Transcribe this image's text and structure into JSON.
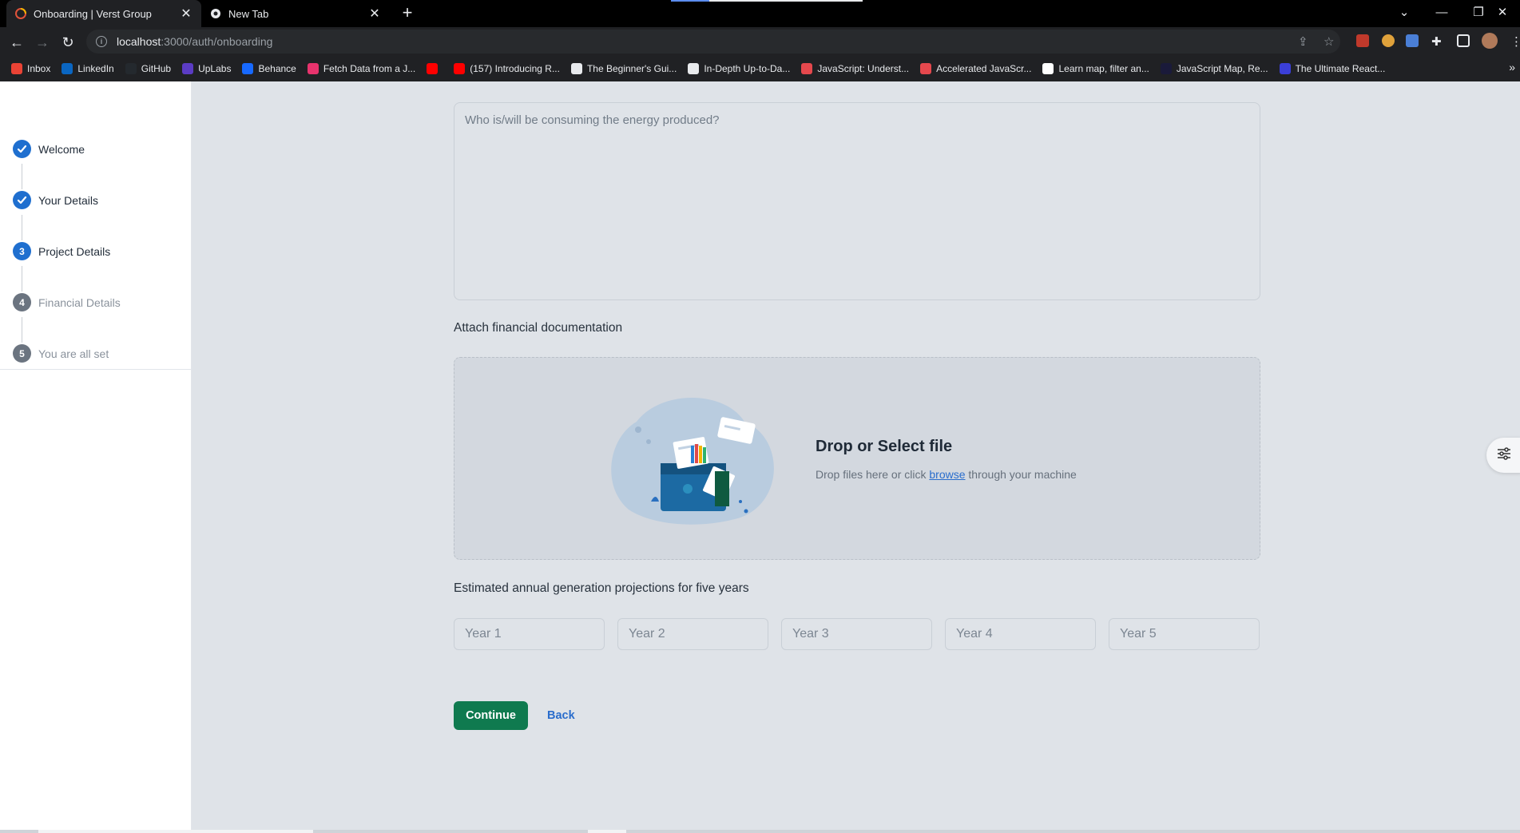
{
  "browser": {
    "tabs": [
      {
        "title": "Onboarding | Verst Group",
        "icon": "verst-favicon",
        "active": true
      },
      {
        "title": "New Tab",
        "icon": "chrome-favicon",
        "active": false
      }
    ],
    "url_host": "localhost",
    "url_path": ":3000/auth/onboarding",
    "bookmarks": [
      {
        "label": "Inbox",
        "icon": "gmail-icon",
        "color": "#ea4335"
      },
      {
        "label": "LinkedIn",
        "icon": "linkedin-icon",
        "color": "#0a66c2"
      },
      {
        "label": "GitHub",
        "icon": "github-icon",
        "color": "#24292e"
      },
      {
        "label": "UpLabs",
        "icon": "uplabs-icon",
        "color": "#5b3cc4"
      },
      {
        "label": "Behance",
        "icon": "behance-icon",
        "color": "#1769ff"
      },
      {
        "label": "Fetch Data from a J...",
        "icon": "pink-icon",
        "color": "#e8336d"
      },
      {
        "label": "",
        "icon": "youtube-icon",
        "color": "#ff0000"
      },
      {
        "label": "(157) Introducing R...",
        "icon": "youtube-icon",
        "color": "#ff0000"
      },
      {
        "label": "The Beginner's Gui...",
        "icon": "ghost-icon",
        "color": "#e8eaed"
      },
      {
        "label": "In-Depth Up-to-Da...",
        "icon": "ghost-icon",
        "color": "#e8eaed"
      },
      {
        "label": "JavaScript: Underst...",
        "icon": "udemy-icon",
        "color": "#e5484d"
      },
      {
        "label": "Accelerated JavaScr...",
        "icon": "udemy-icon",
        "color": "#e5484d"
      },
      {
        "label": "Learn map, filter an...",
        "icon": "medium-icon",
        "color": "#ffffff"
      },
      {
        "label": "JavaScript Map, Re...",
        "icon": "lambda-icon",
        "color": "#1a1a3a"
      },
      {
        "label": "The Ultimate React...",
        "icon": "js-icon",
        "color": "#3b3fd8"
      }
    ]
  },
  "sidebar": {
    "steps": [
      {
        "label": "Welcome",
        "status": "done",
        "number": ""
      },
      {
        "label": "Your Details",
        "status": "done",
        "number": ""
      },
      {
        "label": "Project Details",
        "status": "current",
        "number": "3"
      },
      {
        "label": "Financial Details",
        "status": "todo",
        "number": "4"
      },
      {
        "label": "You are all set",
        "status": "todo",
        "number": "5"
      }
    ]
  },
  "form": {
    "consumer_placeholder": "Who is/will be consuming the energy produced?",
    "attach_label": "Attach financial documentation",
    "dropzone_title": "Drop or Select file",
    "dropzone_sub_before": "Drop files here or click ",
    "dropzone_link": "browse",
    "dropzone_sub_after": " through your machine",
    "projections_label": "Estimated annual generation projections for five years",
    "years": [
      "Year 1",
      "Year 2",
      "Year 3",
      "Year 4",
      "Year 5"
    ],
    "continue_label": "Continue",
    "back_label": "Back"
  },
  "colors": {
    "primary": "#1f6fcf",
    "success": "#0f7a4f",
    "link": "#2a6dcc"
  }
}
